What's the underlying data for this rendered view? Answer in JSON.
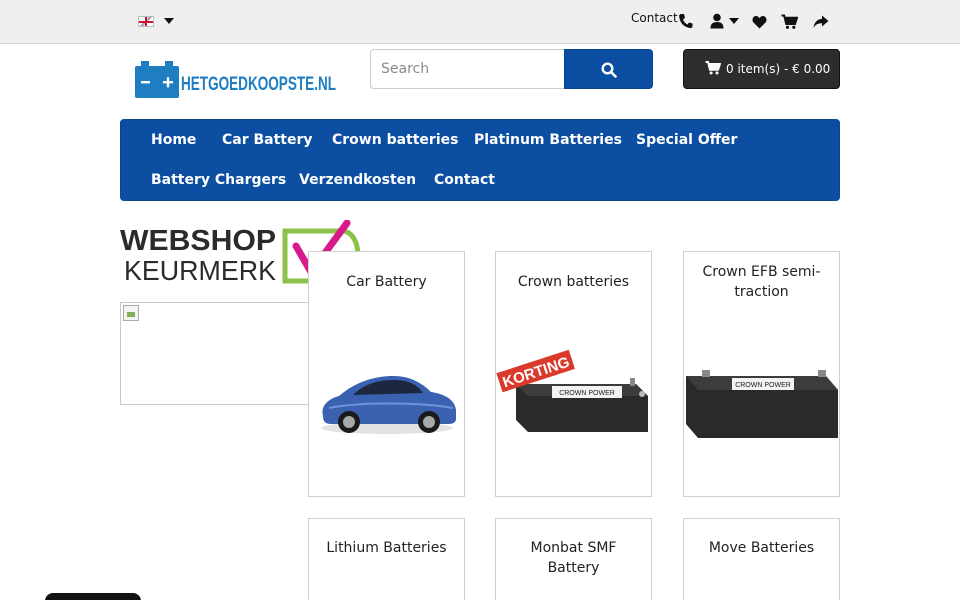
{
  "topbar": {
    "language": "English",
    "contact_label": "Contact",
    "icons": [
      "phone-icon",
      "user-icon",
      "heart-icon",
      "cart-icon",
      "share-icon"
    ]
  },
  "header": {
    "logo_text": "HETGOEDKOOPSTE.NL",
    "search": {
      "placeholder": "Search",
      "value": ""
    },
    "cart_label": "0 item(s) - € 0.00"
  },
  "nav": {
    "items": [
      "Home",
      "Car Battery",
      "Crown batteries",
      "Platinum Batteries",
      "Special Offer",
      "Battery Chargers",
      "Verzendkosten",
      "Contact"
    ]
  },
  "sidebar": {
    "keurmerk_line1": "WEBSHOP",
    "keurmerk_line2": "KEURMERK"
  },
  "categories": [
    {
      "title": "Car Battery",
      "image": "car"
    },
    {
      "title": "Crown batteries",
      "image": "battery-korting",
      "badge": "KORTING"
    },
    {
      "title": "Crown EFB semi-traction",
      "image": "battery"
    },
    {
      "title": "Lithium Batteries",
      "image": ""
    },
    {
      "title": "Monbat SMF Battery",
      "image": ""
    },
    {
      "title": "Move Batteries",
      "image": ""
    }
  ],
  "battery_label": "CROWN POWER",
  "colors": {
    "brand_blue": "#0b4ea2",
    "topbar_bg": "#efefef",
    "cart_bg": "#2d2d2d",
    "keurmerk_green": "#8bc34a",
    "keurmerk_pink": "#d81b8c"
  }
}
